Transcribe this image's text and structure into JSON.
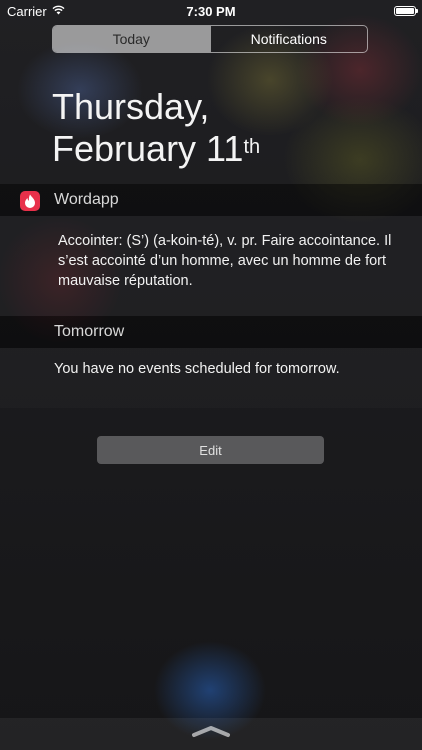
{
  "status_bar": {
    "carrier": "Carrier",
    "time": "7:30 PM",
    "battery_level": 1.0
  },
  "segments": [
    {
      "label": "Today",
      "selected": true
    },
    {
      "label": "Notifications",
      "selected": false
    }
  ],
  "date": {
    "line1": "Thursday,",
    "line2": "February 11",
    "suffix": "th"
  },
  "wordapp": {
    "app_name": "Wordapp",
    "icon": "flame-icon",
    "accent_color": "#e8304a",
    "text": "Accointer: (S’) (a-koin-té), v. pr. Faire accointance. Il s’est accointé d’un homme, avec un homme de fort mauvaise réputation."
  },
  "tomorrow": {
    "title": "Tomorrow",
    "text": "You have no events scheduled for tomorrow."
  },
  "edit_button": {
    "label": "Edit"
  }
}
